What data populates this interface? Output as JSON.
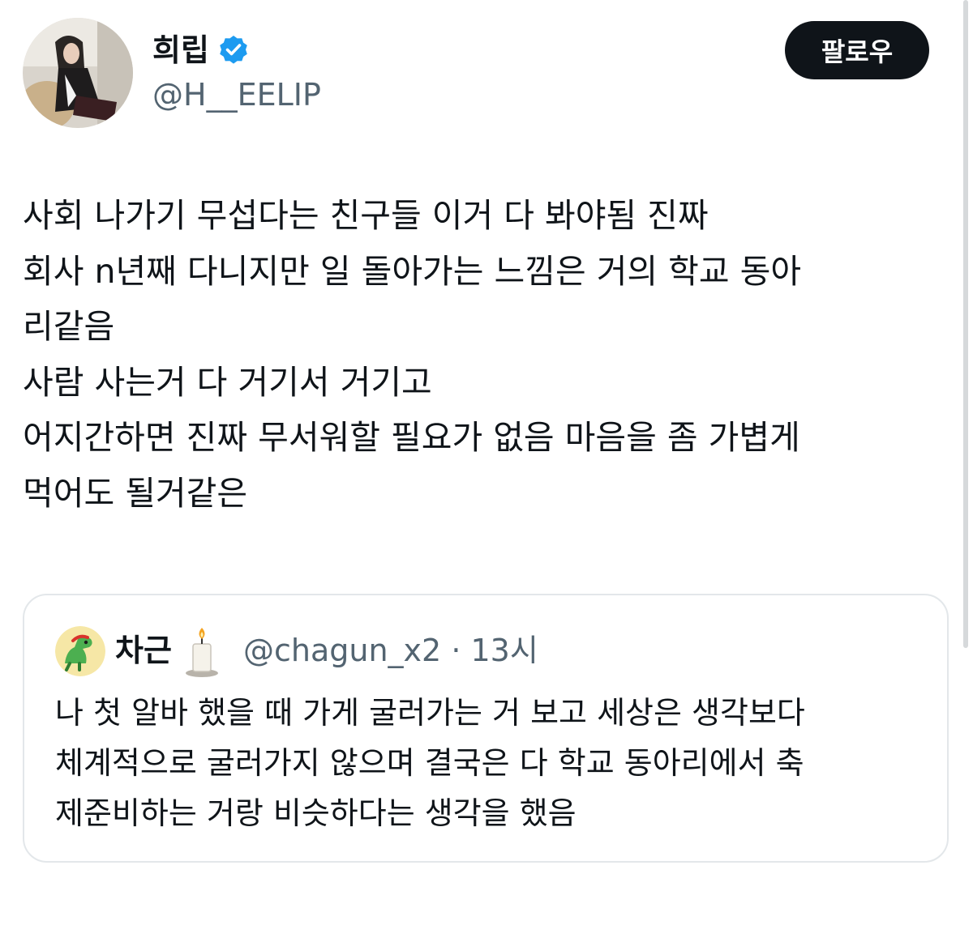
{
  "author": {
    "display_name": "희립",
    "handle": "@H__EELIP",
    "verified_icon": "verified-badge-icon",
    "avatar": "profile-photo"
  },
  "follow_button": {
    "label": "팔로우"
  },
  "tweet": {
    "lines": [
      "사회 나가기 무섭다는 친구들 이거 다 봐야됨 진짜",
      "회사 n년째 다니지만 일 돌아가는 느낌은 거의 학교 동아",
      "리같음",
      "사람 사는거 다 거기서 거기고",
      "어지간하면 진짜 무서워할 필요가 없음 마음을 좀 가볍게",
      "먹어도 될거같은"
    ]
  },
  "quote": {
    "display_name": "차근",
    "name_emoji": "candle-icon",
    "handle": "@chagun_x2",
    "separator": "·",
    "time": "13시",
    "avatar": "green-dinosaur-avatar",
    "lines": [
      "나 첫 알바 했을 때 가게 굴러가는 거 보고 세상은 생각보다",
      "체계적으로 굴러가지 않으며 결국은 다 학교 동아리에서 축",
      "제준비하는 거랑 비슷하다는 생각을 했음"
    ]
  },
  "colors": {
    "text_primary": "#0f1419",
    "text_secondary": "#536471",
    "verified_blue": "#1d9bf0",
    "button_bg": "#0f1419",
    "card_border": "#e3e7ea"
  }
}
